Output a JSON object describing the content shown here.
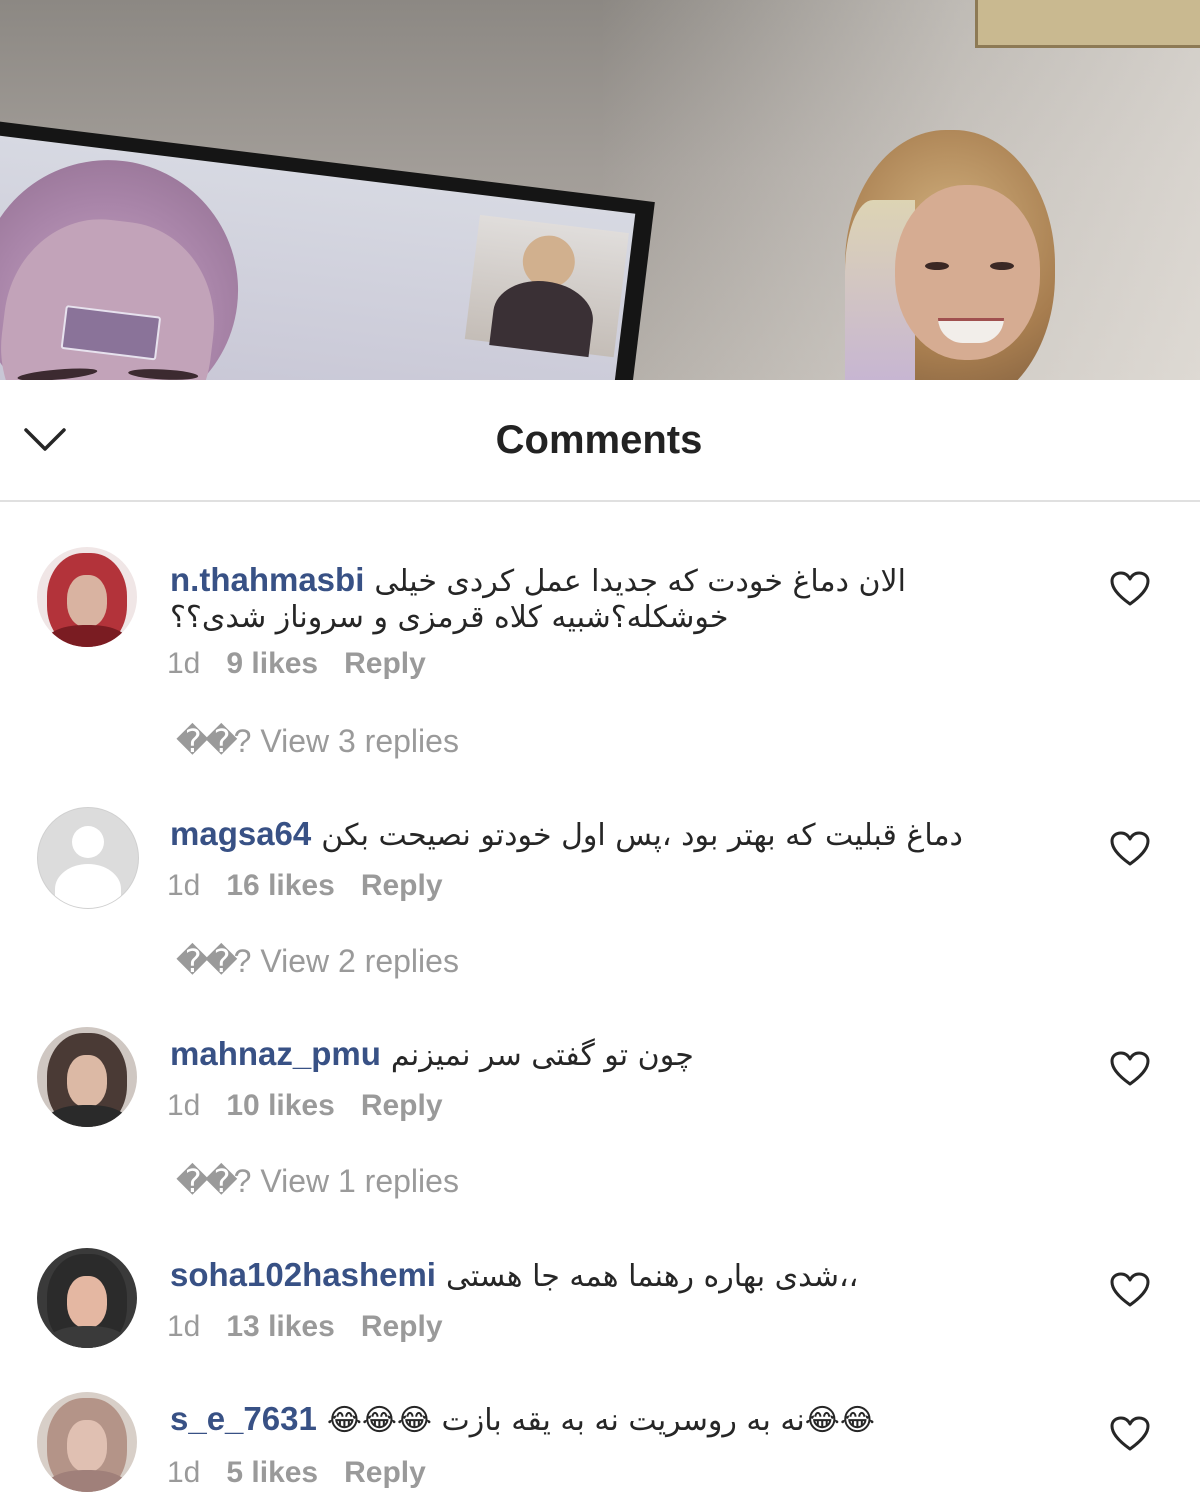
{
  "header": {
    "title": "Comments"
  },
  "comments": [
    {
      "username": "n.thahmasbi",
      "text_line1": "الان دماغ خودت که جدیدا عمل کردی خیلی",
      "text_line2": "خوشکله؟شبیه کلاه قرمزی و سروناز شدی؟؟",
      "time": "1d",
      "likes": "9 likes",
      "reply_label": "Reply",
      "view_replies": "View 3 replies",
      "avatar_colors": [
        "#b3333a",
        "#d9b3a1",
        "#7a1c22"
      ]
    },
    {
      "username": "magsa64",
      "text_line1": "دماغ قبلیت که بهتر بود ،پس اول خودتو نصیحت بکن",
      "time": "1d",
      "likes": "16 likes",
      "reply_label": "Reply",
      "view_replies": "View 2 replies"
    },
    {
      "username": "mahnaz_pmu",
      "text_line1": "چون تو گفتی سر نمیزنم",
      "time": "1d",
      "likes": "10 likes",
      "reply_label": "Reply",
      "view_replies": "View 1 replies",
      "avatar_colors": [
        "#4a3a35",
        "#dcb9a5",
        "#2a2a2a"
      ]
    },
    {
      "username": "soha102hashemi",
      "text_line1": "،،شدی بهاره رهنما همه جا هستی",
      "time": "1d",
      "likes": "13 likes",
      "reply_label": "Reply",
      "avatar_colors": [
        "#2b2b2b",
        "#e4b7a2",
        "#3a3a3a"
      ]
    },
    {
      "username": "s_e_7631",
      "text_line1": "😂😂نه به روسریت نه به یقه بازت 😂😂😂",
      "time": "1d",
      "likes": "5 likes",
      "reply_label": "Reply",
      "avatar_colors": [
        "#b49488",
        "#e0c0b2",
        "#a0807a"
      ]
    }
  ],
  "icons": {
    "back": "chevron-down-icon",
    "like": "heart-outline-icon"
  },
  "colors": {
    "username": "#385185",
    "meta": "#9a9a9a",
    "text": "#262626"
  }
}
